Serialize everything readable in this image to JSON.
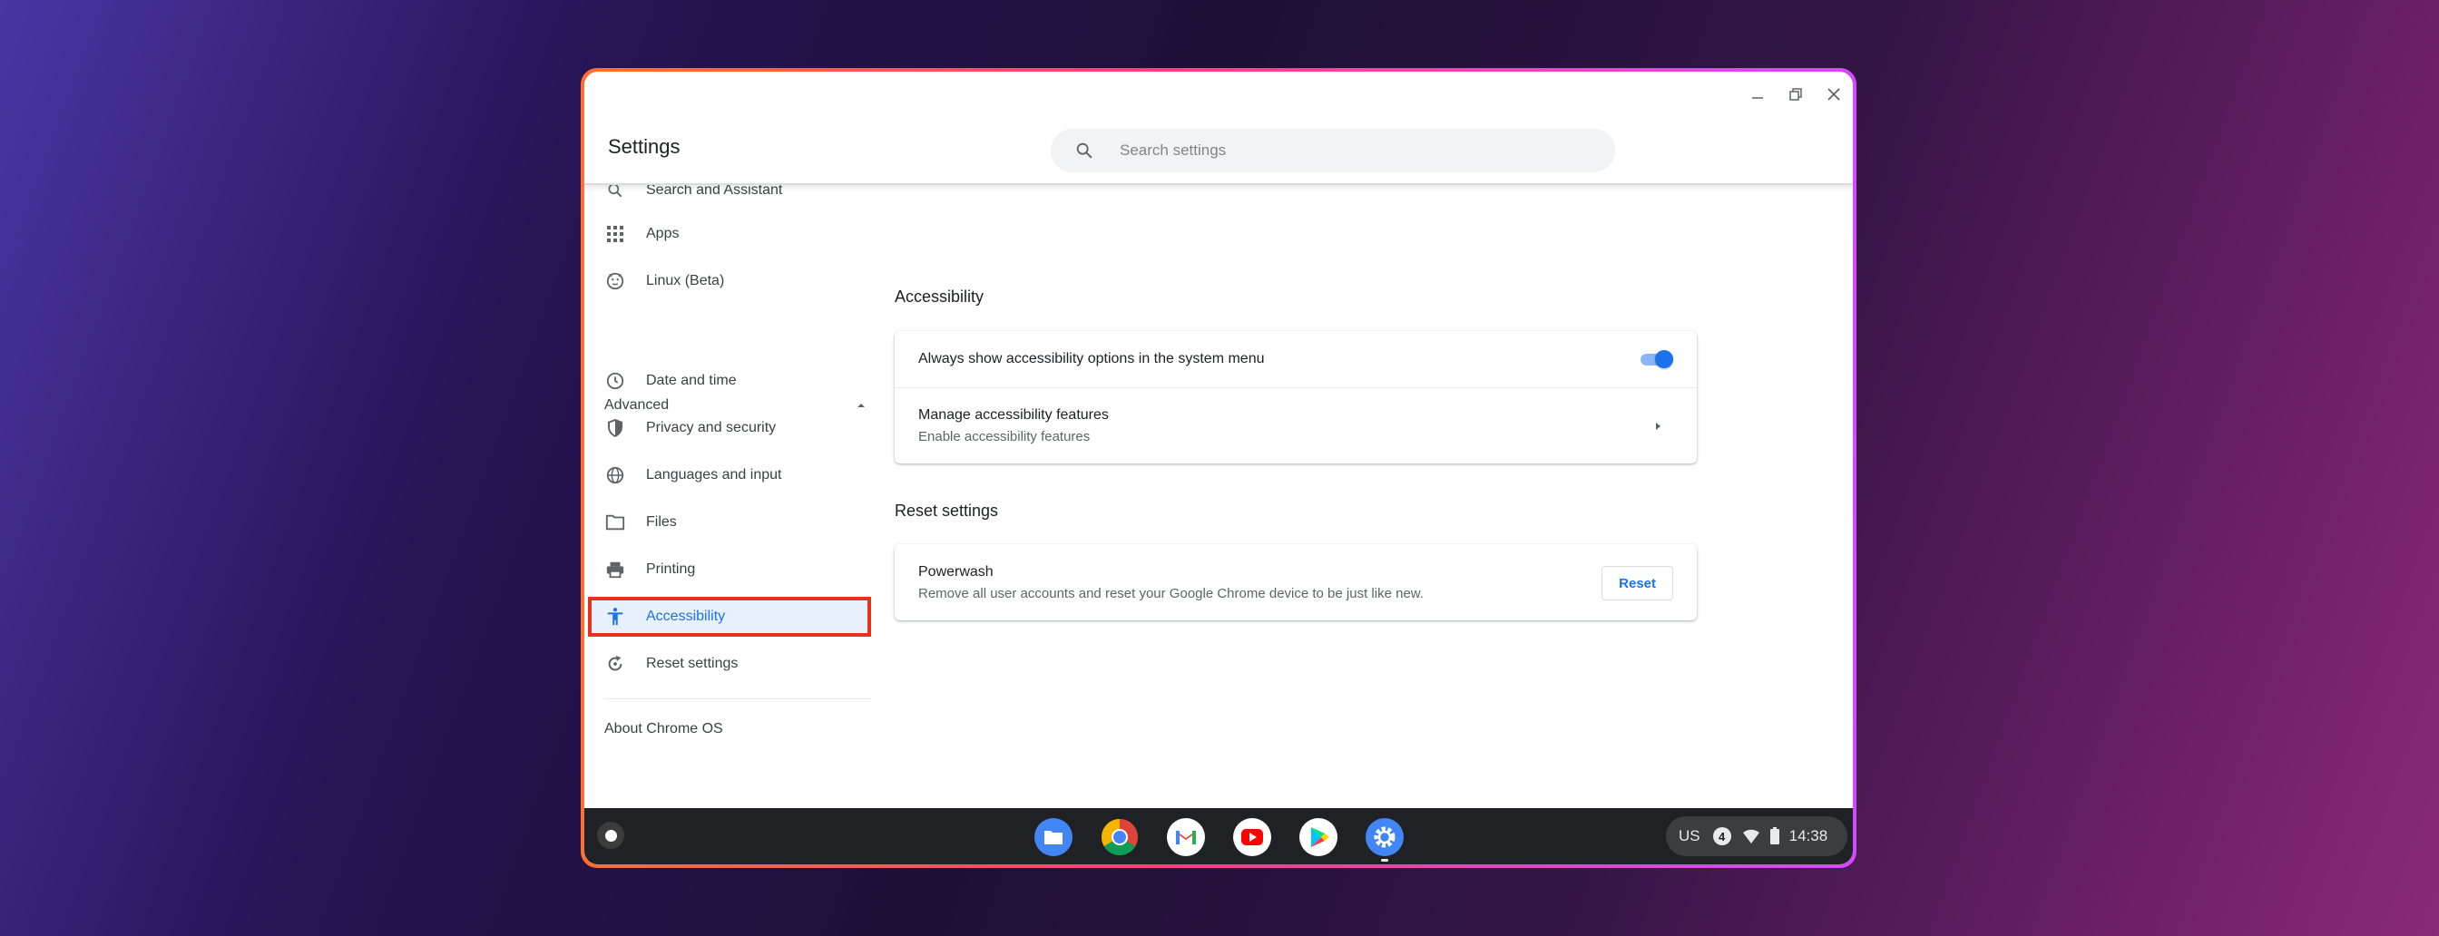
{
  "window": {
    "title": "Settings",
    "controls": [
      "minimize",
      "maximize",
      "close"
    ]
  },
  "search": {
    "placeholder": "Search settings"
  },
  "sidebar": {
    "items_top": [
      {
        "label": "Search and Assistant",
        "icon": "search-icon"
      },
      {
        "label": "Apps",
        "icon": "apps-grid-icon"
      },
      {
        "label": "Linux (Beta)",
        "icon": "linux-penguin-icon"
      }
    ],
    "advanced_label": "Advanced",
    "items_advanced": [
      {
        "label": "Date and time",
        "icon": "clock-icon"
      },
      {
        "label": "Privacy and security",
        "icon": "shield-icon"
      },
      {
        "label": "Languages and input",
        "icon": "globe-icon"
      },
      {
        "label": "Files",
        "icon": "folder-icon"
      },
      {
        "label": "Printing",
        "icon": "printer-icon"
      },
      {
        "label": "Accessibility",
        "icon": "accessibility-icon",
        "selected": true
      },
      {
        "label": "Reset settings",
        "icon": "reset-icon"
      }
    ],
    "about_label": "About Chrome OS"
  },
  "main": {
    "accessibility": {
      "title": "Accessibility",
      "always_show_label": "Always show accessibility options in the system menu",
      "always_show_enabled": true,
      "manage_title": "Manage accessibility features",
      "manage_subtitle": "Enable accessibility features"
    },
    "reset": {
      "title": "Reset settings",
      "powerwash_title": "Powerwash",
      "powerwash_subtitle": "Remove all user accounts and reset your Google Chrome device to be just like new.",
      "reset_button": "Reset"
    }
  },
  "shelf": {
    "apps": [
      "files-icon",
      "chrome-icon",
      "gmail-icon",
      "youtube-icon",
      "play-store-icon",
      "settings-gear-icon"
    ],
    "tray": {
      "keyboard_layout": "US",
      "notification_count": "4",
      "time": "14:38"
    }
  },
  "colors": {
    "accent": "#1a73e8",
    "selected_bg": "#e8f0fe",
    "highlight_box": "#e8321e",
    "shelf_bg": "#202124"
  }
}
